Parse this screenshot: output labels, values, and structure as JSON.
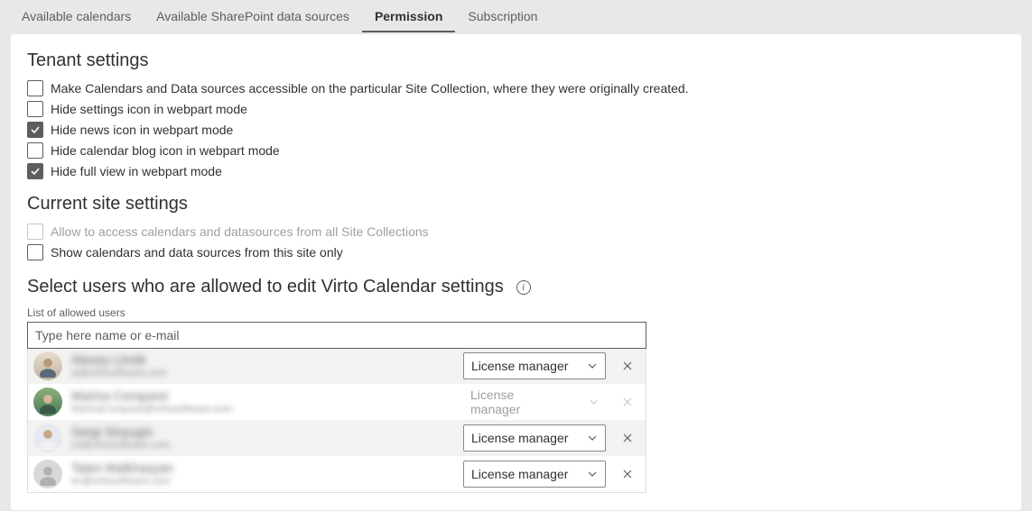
{
  "tabs": [
    {
      "label": "Available calendars",
      "active": false
    },
    {
      "label": "Available SharePoint data sources",
      "active": false
    },
    {
      "label": "Permission",
      "active": true
    },
    {
      "label": "Subscription",
      "active": false
    }
  ],
  "tenant": {
    "heading": "Tenant settings",
    "items": [
      {
        "label": "Make Calendars and Data sources accessible on the particular Site Collection, where they were originally created.",
        "checked": false
      },
      {
        "label": "Hide settings icon in webpart mode",
        "checked": false
      },
      {
        "label": "Hide news icon in webpart mode",
        "checked": true
      },
      {
        "label": "Hide calendar blog icon in webpart mode",
        "checked": false
      },
      {
        "label": "Hide full view in webpart mode",
        "checked": true
      }
    ]
  },
  "site": {
    "heading": "Current site settings",
    "items": [
      {
        "label": "Allow to access calendars and datasources from all Site Collections",
        "checked": false,
        "disabled": true
      },
      {
        "label": "Show calendars and data sources from this site only",
        "checked": false,
        "disabled": false
      }
    ]
  },
  "selectUsers": {
    "heading": "Select users who are allowed to edit Virto Calendar settings",
    "listLabel": "List of allowed users",
    "placeholder": "Type here name or e-mail"
  },
  "users": [
    {
      "name": "Alexey Linnik",
      "email": "al@virtosoftware.com",
      "role": "License manager",
      "disabled": false,
      "avatar": "person1"
    },
    {
      "name": "Marina Conquest",
      "email": "MarinaConquest@virtosoftware.com",
      "role": "License manager",
      "disabled": true,
      "avatar": "person2"
    },
    {
      "name": "Sergi Sinyugin",
      "email": "sd@virtosoftware.com",
      "role": "License manager",
      "disabled": false,
      "avatar": "person3"
    },
    {
      "name": "Taten Malkhasyan",
      "email": "tm@virtosoftware.com",
      "role": "License manager",
      "disabled": false,
      "avatar": "silhouette"
    }
  ]
}
